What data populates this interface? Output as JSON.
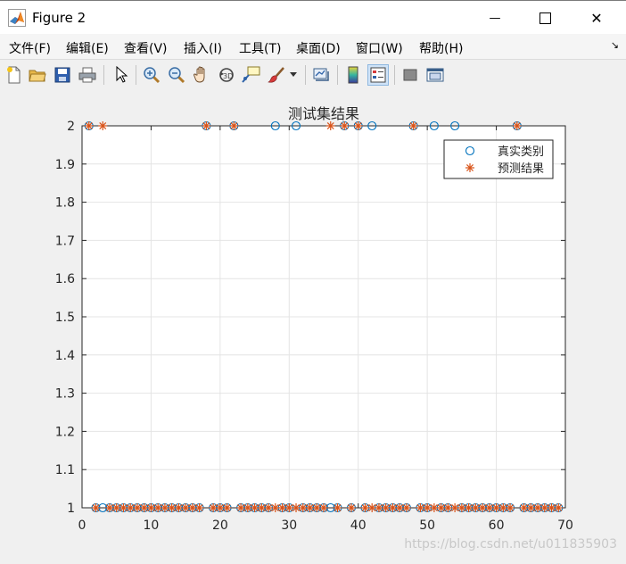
{
  "window": {
    "title": "Figure 2",
    "minimize_glyph": "—",
    "maximize_glyph": "☐",
    "close_glyph": "✕"
  },
  "menu": {
    "items": [
      "文件(F)",
      "编辑(E)",
      "查看(V)",
      "插入(I)",
      "工具(T)",
      "桌面(D)",
      "窗口(W)",
      "帮助(H)"
    ],
    "dock_glyph": "↘"
  },
  "toolbar": {
    "icons": [
      "new-figure-icon",
      "open-file-icon",
      "save-icon",
      "print-icon",
      "pointer-icon",
      "zoom-in-icon",
      "zoom-out-icon",
      "pan-hand-icon",
      "rotate-3d-icon",
      "data-cursor-icon",
      "brush-icon",
      "brush-dropdown-icon",
      "link-plot-icon",
      "colorbar-icon",
      "legend-icon",
      "hide-plot-tools-icon",
      "show-plot-tools-icon"
    ]
  },
  "watermark": "https://blog.csdn.net/u011835903",
  "chart_data": {
    "type": "scatter",
    "title": "测试集结果",
    "xlabel": "",
    "ylabel": "",
    "xlim": [
      0,
      70
    ],
    "ylim": [
      1,
      2
    ],
    "xticks": [
      "0",
      "10",
      "20",
      "30",
      "40",
      "50",
      "60",
      "70"
    ],
    "yticks": [
      "1",
      "1.1",
      "1.2",
      "1.3",
      "1.4",
      "1.5",
      "1.6",
      "1.7",
      "1.8",
      "1.9",
      "2"
    ],
    "grid": true,
    "legend_position": "top-right",
    "series": [
      {
        "name": "真实类别",
        "marker": "circle",
        "color": "#0072bd",
        "x": [
          1,
          2,
          3,
          4,
          5,
          6,
          7,
          8,
          9,
          10,
          11,
          12,
          13,
          14,
          15,
          16,
          17,
          18,
          19,
          20,
          21,
          22,
          23,
          24,
          25,
          26,
          27,
          28,
          29,
          30,
          31,
          32,
          33,
          34,
          35,
          36,
          37,
          38,
          39,
          40,
          41,
          42,
          43,
          44,
          45,
          46,
          47,
          48,
          49,
          50,
          51,
          52,
          53,
          54,
          55,
          56,
          57,
          58,
          59,
          60,
          61,
          62,
          63,
          64,
          65,
          66,
          67,
          68,
          69
        ],
        "y": [
          2,
          1,
          1,
          1,
          1,
          1,
          1,
          1,
          1,
          1,
          1,
          1,
          1,
          1,
          1,
          1,
          1,
          2,
          1,
          1,
          1,
          2,
          1,
          1,
          1,
          1,
          1,
          2,
          1,
          1,
          2,
          1,
          1,
          1,
          1,
          1,
          1,
          2,
          1,
          2,
          1,
          2,
          1,
          1,
          1,
          1,
          1,
          2,
          1,
          1,
          2,
          1,
          1,
          2,
          1,
          1,
          1,
          1,
          1,
          1,
          1,
          1,
          2,
          1,
          1,
          1,
          1,
          1,
          1
        ]
      },
      {
        "name": "预测结果",
        "marker": "asterisk",
        "color": "#d95319",
        "x": [
          1,
          2,
          3,
          4,
          5,
          6,
          7,
          8,
          9,
          10,
          11,
          12,
          13,
          14,
          15,
          16,
          17,
          18,
          19,
          20,
          21,
          22,
          23,
          24,
          25,
          26,
          27,
          28,
          29,
          30,
          31,
          32,
          33,
          34,
          35,
          36,
          37,
          38,
          39,
          40,
          41,
          42,
          43,
          44,
          45,
          46,
          47,
          48,
          49,
          50,
          51,
          52,
          53,
          54,
          55,
          56,
          57,
          58,
          59,
          60,
          61,
          62,
          63,
          64,
          65,
          66,
          67,
          68,
          69
        ],
        "y": [
          2,
          1,
          2,
          1,
          1,
          1,
          1,
          1,
          1,
          1,
          1,
          1,
          1,
          1,
          1,
          1,
          1,
          2,
          1,
          1,
          1,
          2,
          1,
          1,
          1,
          1,
          1,
          1,
          1,
          1,
          1,
          1,
          1,
          1,
          1,
          2,
          1,
          2,
          1,
          2,
          1,
          1,
          1,
          1,
          1,
          1,
          1,
          2,
          1,
          1,
          1,
          1,
          1,
          1,
          1,
          1,
          1,
          1,
          1,
          1,
          1,
          1,
          2,
          1,
          1,
          1,
          1,
          1,
          1
        ]
      }
    ]
  }
}
